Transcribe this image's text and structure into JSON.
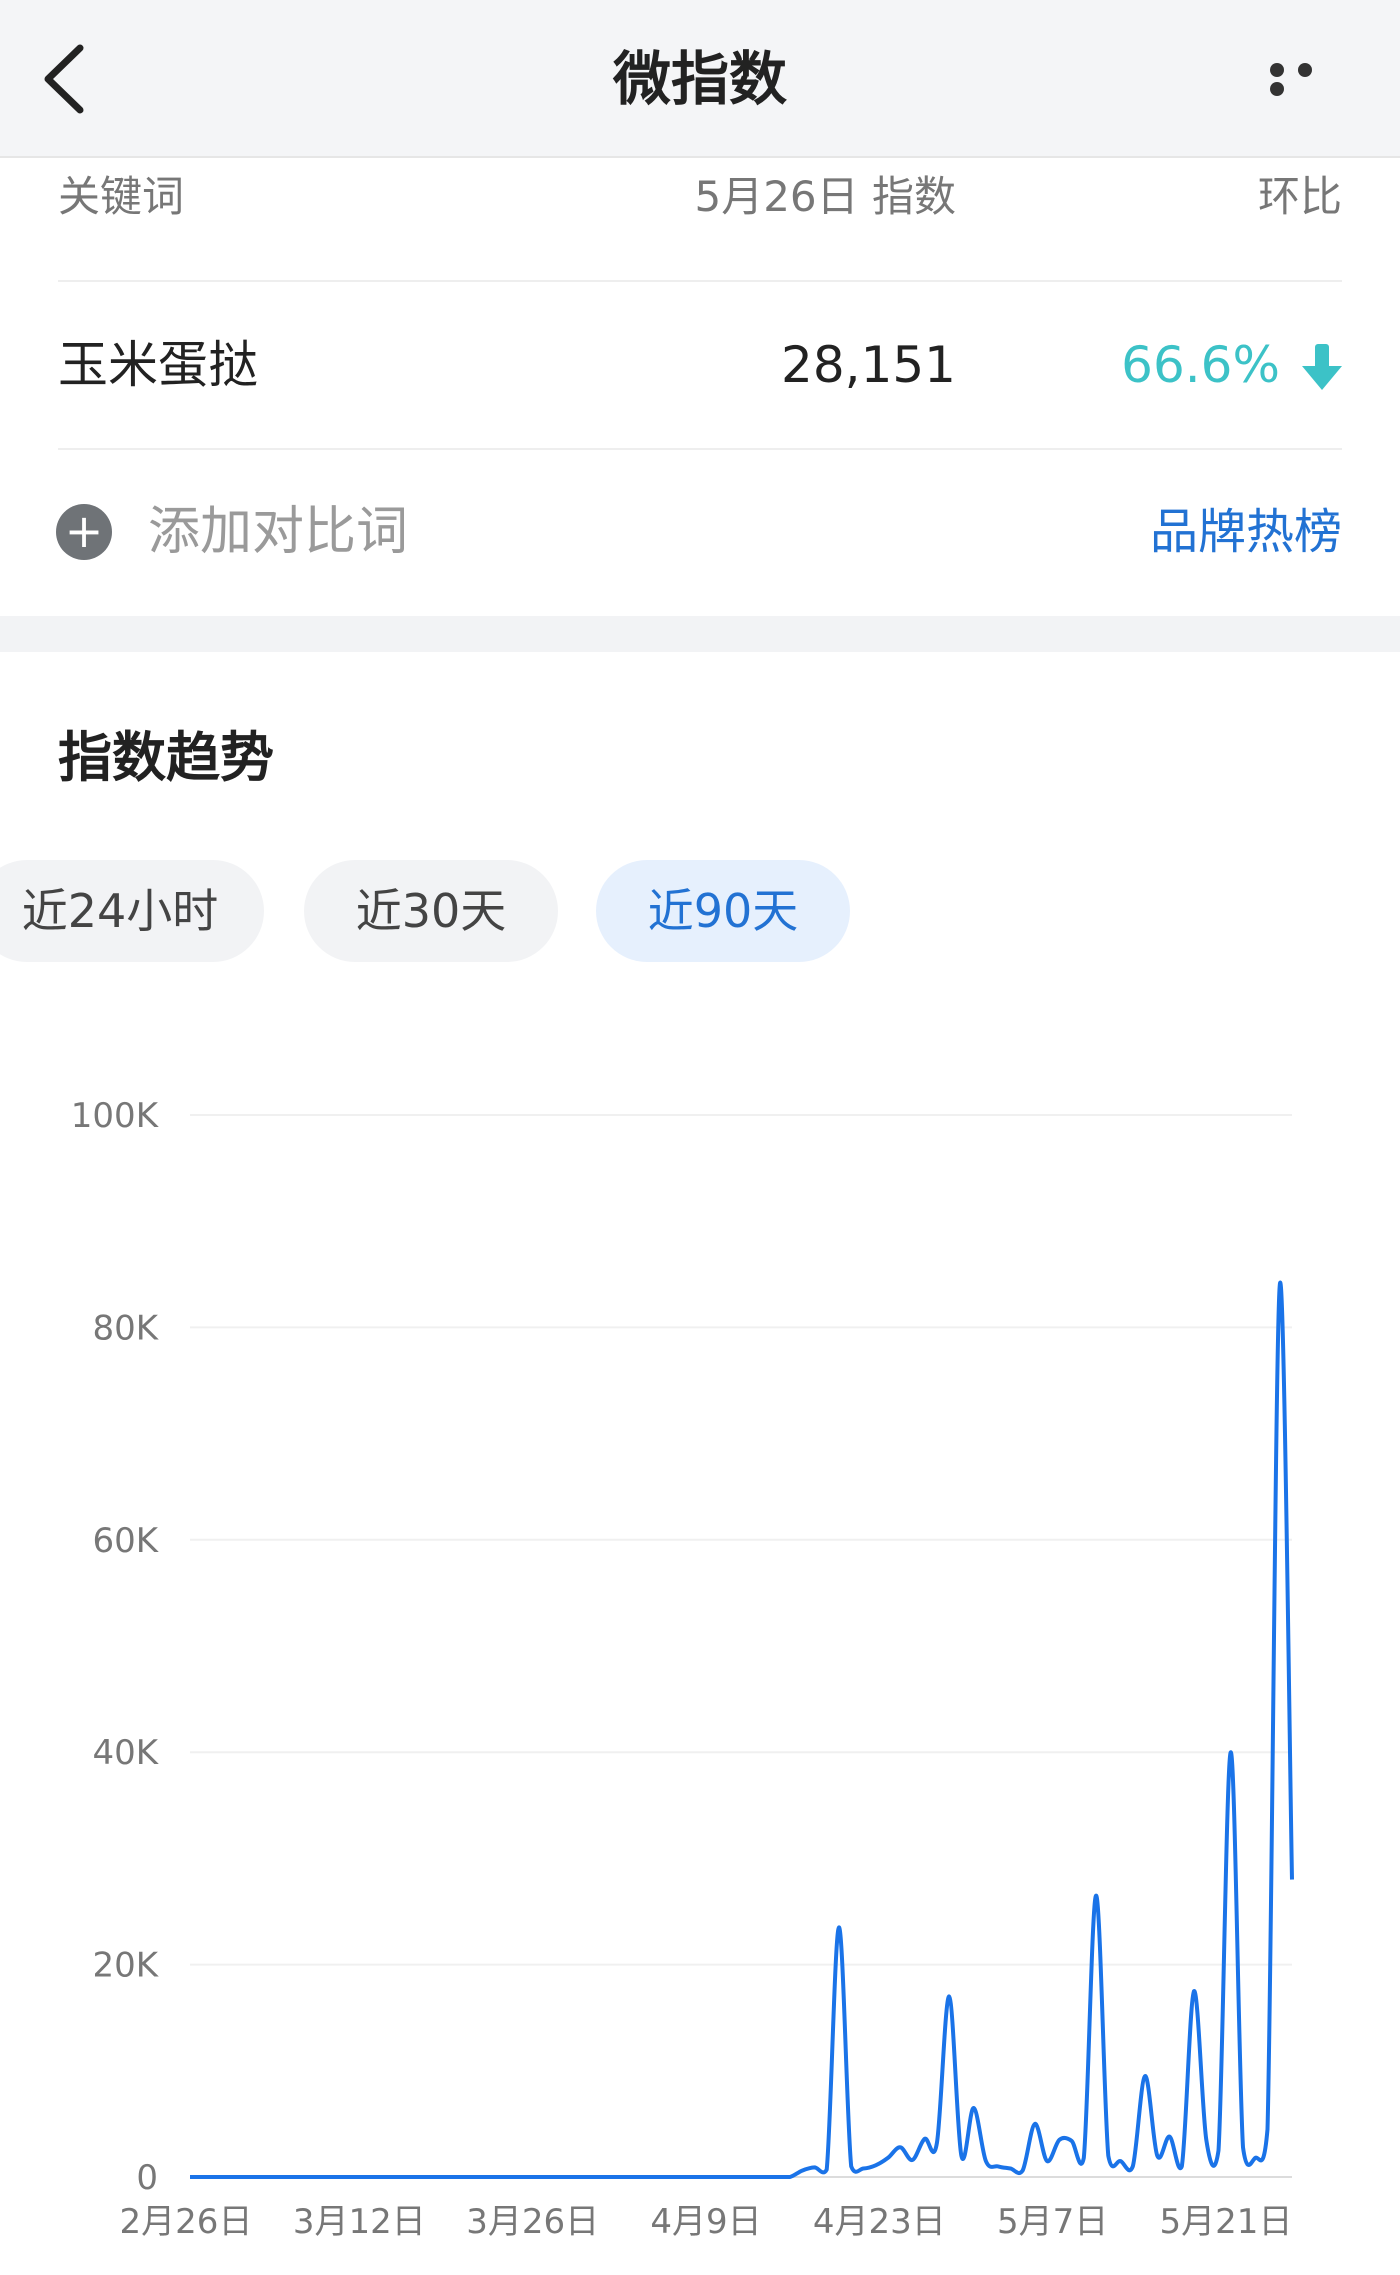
{
  "header": {
    "title": "微指数",
    "back_icon": "chevron-left-icon",
    "more_icon": "more-horizontal-icon"
  },
  "table": {
    "col_keyword": "关键词",
    "col_index": "5月26日 指数",
    "col_change": "环比",
    "row": {
      "keyword": "玉米蛋挞",
      "index": "28,151",
      "change": "66.6%",
      "trend_icon": "arrow-down-icon",
      "trend_color": "#3cc2c7"
    }
  },
  "compare": {
    "add_label": "添加对比词",
    "add_icon": "plus-circle-icon",
    "brand_link": "品牌热榜"
  },
  "trend": {
    "title": "指数趋势",
    "tabs": [
      {
        "label": "近24小时",
        "active": false
      },
      {
        "label": "近30天",
        "active": false
      },
      {
        "label": "近90天",
        "active": true
      }
    ]
  },
  "colors": {
    "accent": "#2272d3",
    "line": "#1a73e8",
    "change": "#3cc2c7"
  },
  "chart_data": {
    "type": "line",
    "x_labels": [
      "2月26日",
      "3月12日",
      "3月26日",
      "4月9日",
      "4月23日",
      "5月7日",
      "5月21日"
    ],
    "y_ticks": [
      "0",
      "20K",
      "40K",
      "60K",
      "80K",
      "100K"
    ],
    "ylim": [
      0,
      100000
    ],
    "grid": true,
    "series": [
      {
        "values": [
          0,
          0,
          0,
          0,
          0,
          0,
          0,
          0,
          0,
          0,
          0,
          0,
          0,
          0,
          0,
          0,
          0,
          0,
          0,
          0,
          0,
          0,
          0,
          0,
          0,
          0,
          0,
          0,
          0,
          0,
          0,
          0,
          0,
          0,
          0,
          0,
          0,
          0,
          0,
          0,
          0,
          0,
          0,
          0,
          0,
          0,
          0,
          0,
          0,
          0,
          600,
          900,
          700,
          23500,
          1000,
          800,
          1100,
          1800,
          2800,
          1600,
          3600,
          3200,
          17000,
          2000,
          6500,
          1500,
          1000,
          800,
          600,
          5000,
          1500,
          3500,
          3400,
          1800,
          26500,
          2000,
          1500,
          1000,
          9500,
          2000,
          3800,
          1000,
          17500,
          3500,
          2500,
          40000,
          2800,
          1800,
          4500,
          84000,
          28000
        ]
      }
    ]
  }
}
